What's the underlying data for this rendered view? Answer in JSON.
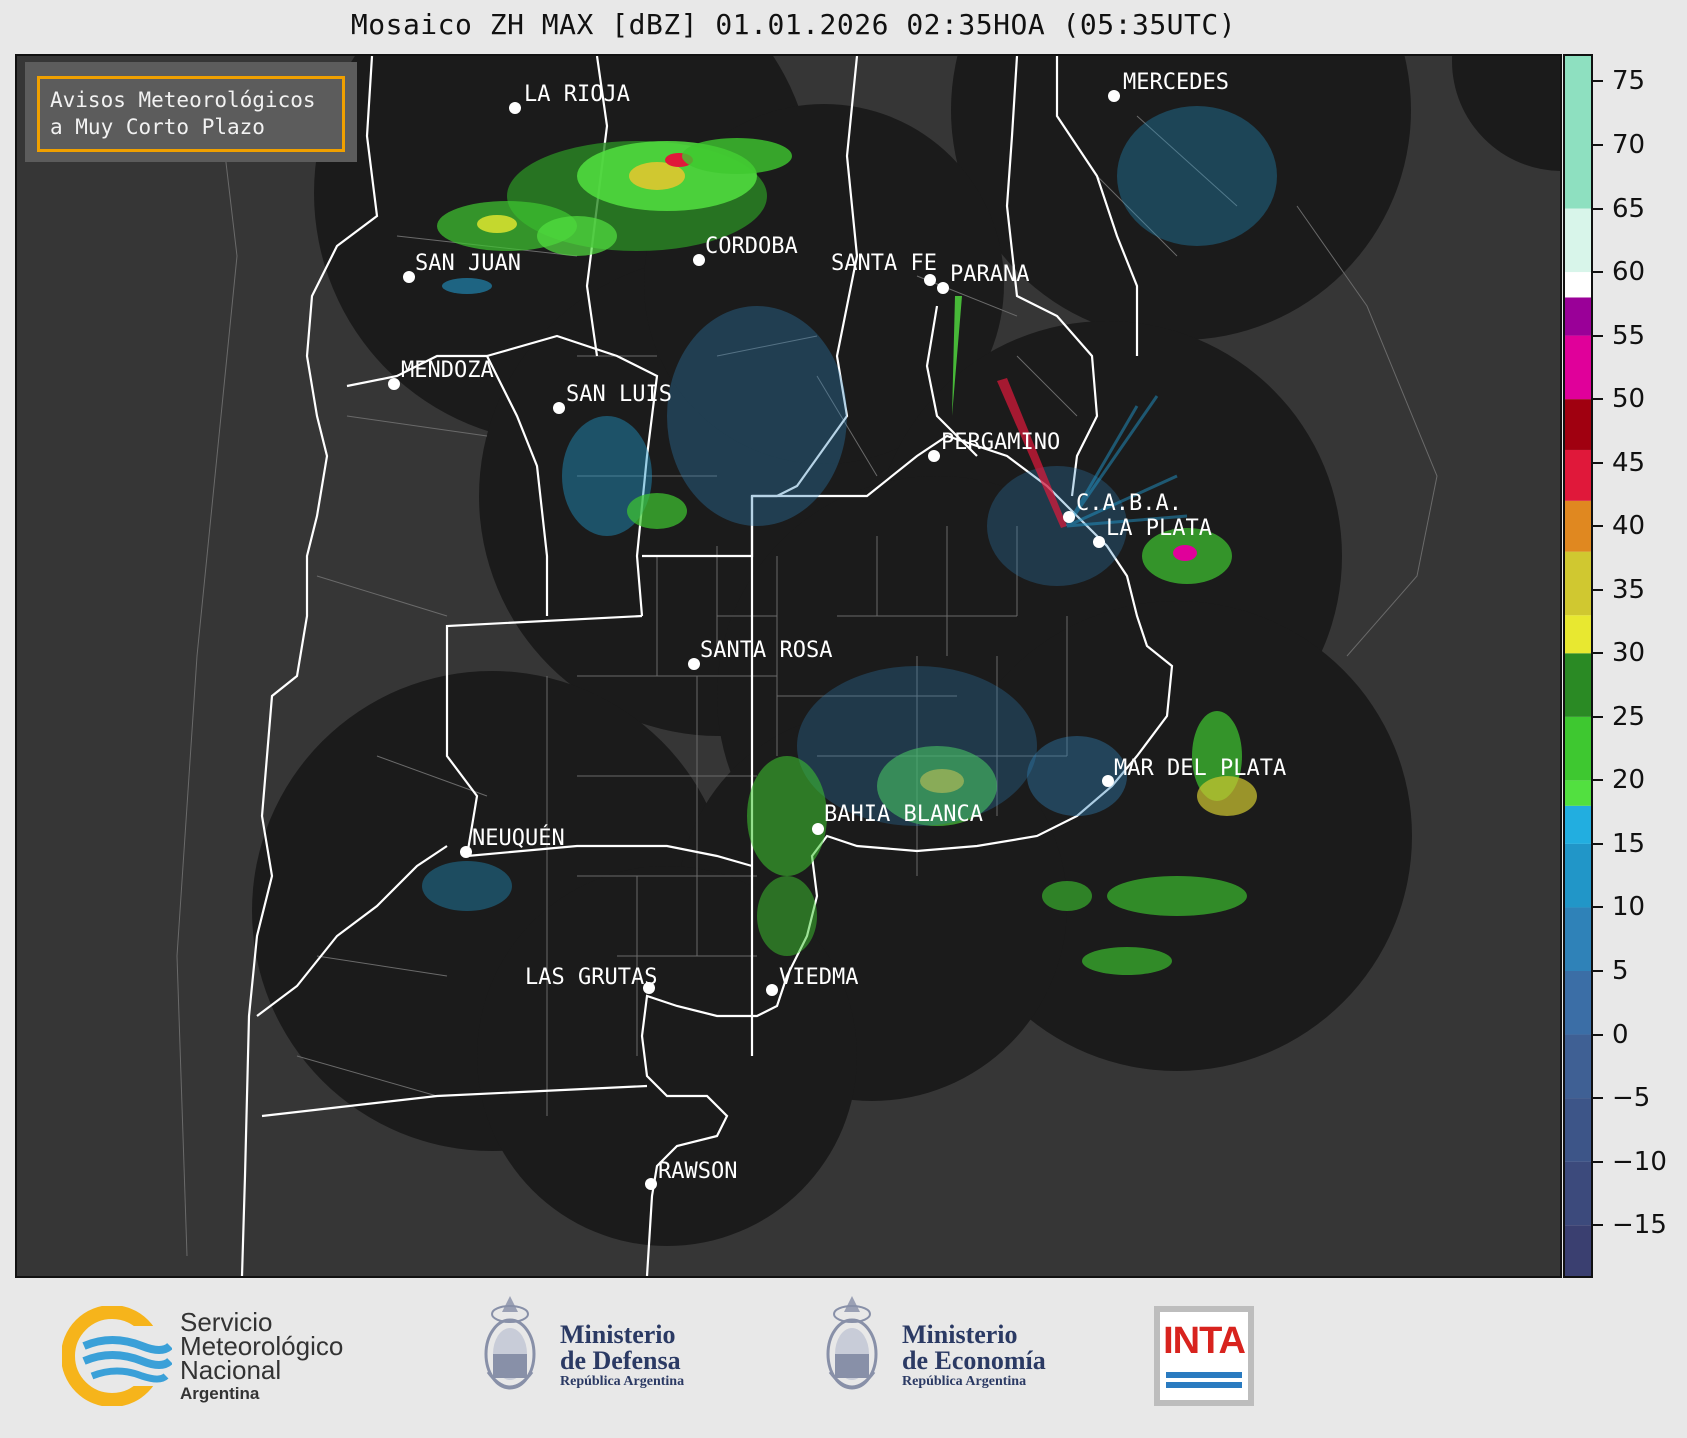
{
  "title": "Mosaico ZH MAX [dBZ] 01.01.2026 02:35HOA (05:35UTC)",
  "aviso": {
    "text": "Avisos Meteorológicos\na Muy Corto Plazo"
  },
  "cities": [
    {
      "name": "LA RIOJA"
    },
    {
      "name": "MERCEDES"
    },
    {
      "name": "SAN JUAN"
    },
    {
      "name": "CORDOBA"
    },
    {
      "name": "SANTA FE"
    },
    {
      "name": "PARANA"
    },
    {
      "name": "MENDOZA"
    },
    {
      "name": "SAN LUIS"
    },
    {
      "name": "PERGAMINO"
    },
    {
      "name": "C.A.B.A."
    },
    {
      "name": "LA PLATA"
    },
    {
      "name": "SANTA ROSA"
    },
    {
      "name": "MAR DEL PLATA"
    },
    {
      "name": "BAHIA BLANCA"
    },
    {
      "name": "NEUQUÉN"
    },
    {
      "name": "LAS GRUTAS"
    },
    {
      "name": "VIEDMA"
    },
    {
      "name": "RAWSON"
    }
  ],
  "colorbar": {
    "unit": "dBZ",
    "min": -19,
    "max": 77,
    "ticks": [
      {
        "value": 75,
        "label": "75"
      },
      {
        "value": 70,
        "label": "70"
      },
      {
        "value": 65,
        "label": "65"
      },
      {
        "value": 60,
        "label": "60"
      },
      {
        "value": 55,
        "label": "55"
      },
      {
        "value": 50,
        "label": "50"
      },
      {
        "value": 45,
        "label": "45"
      },
      {
        "value": 40,
        "label": "40"
      },
      {
        "value": 35,
        "label": "35"
      },
      {
        "value": 30,
        "label": "30"
      },
      {
        "value": 25,
        "label": "25"
      },
      {
        "value": 20,
        "label": "20"
      },
      {
        "value": 15,
        "label": "15"
      },
      {
        "value": 10,
        "label": "10"
      },
      {
        "value": 5,
        "label": "5"
      },
      {
        "value": 0,
        "label": "0"
      },
      {
        "value": -5,
        "label": "−5"
      },
      {
        "value": -10,
        "label": "−10"
      },
      {
        "value": -15,
        "label": "−15"
      }
    ],
    "bands": [
      {
        "from": -19,
        "to": -15,
        "color": "#3a3f70"
      },
      {
        "from": -15,
        "to": -10,
        "color": "#3c4a7c"
      },
      {
        "from": -10,
        "to": -5,
        "color": "#3d5588"
      },
      {
        "from": -5,
        "to": 0,
        "color": "#3f6094"
      },
      {
        "from": 0,
        "to": 5,
        "color": "#3b6ea6"
      },
      {
        "from": 5,
        "to": 10,
        "color": "#2f82b8"
      },
      {
        "from": 10,
        "to": 15,
        "color": "#2196c8"
      },
      {
        "from": 15,
        "to": 18,
        "color": "#22aee0"
      },
      {
        "from": 18,
        "to": 20,
        "color": "#52e040"
      },
      {
        "from": 20,
        "to": 25,
        "color": "#3ec830"
      },
      {
        "from": 25,
        "to": 30,
        "color": "#2a8a24"
      },
      {
        "from": 30,
        "to": 33,
        "color": "#e8e830"
      },
      {
        "from": 33,
        "to": 38,
        "color": "#d0c830"
      },
      {
        "from": 38,
        "to": 42,
        "color": "#e08820"
      },
      {
        "from": 42,
        "to": 46,
        "color": "#e0183a"
      },
      {
        "from": 46,
        "to": 50,
        "color": "#a00010"
      },
      {
        "from": 50,
        "to": 55,
        "color": "#e0009a"
      },
      {
        "from": 55,
        "to": 58,
        "color": "#9a0098"
      },
      {
        "from": 58,
        "to": 60,
        "color": "#ffffff"
      },
      {
        "from": 60,
        "to": 65,
        "color": "#d8f5ea"
      },
      {
        "from": 65,
        "to": 77,
        "color": "#8ee0c0"
      }
    ]
  },
  "logos": {
    "smn": {
      "line1": "Servicio",
      "line2": "Meteorológico",
      "line3": "Nacional",
      "sub": "Argentina"
    },
    "defensa": {
      "line1": "Ministerio",
      "line2": "de Defensa",
      "sub": "República Argentina"
    },
    "economia": {
      "line1": "Ministerio",
      "line2": "de Economía",
      "sub": "República Argentina"
    },
    "inta": {
      "text": "INTA"
    }
  },
  "colors": {
    "radar_coverage": "#1b1b1b",
    "land": "#363636",
    "accent": "#f0a000"
  }
}
